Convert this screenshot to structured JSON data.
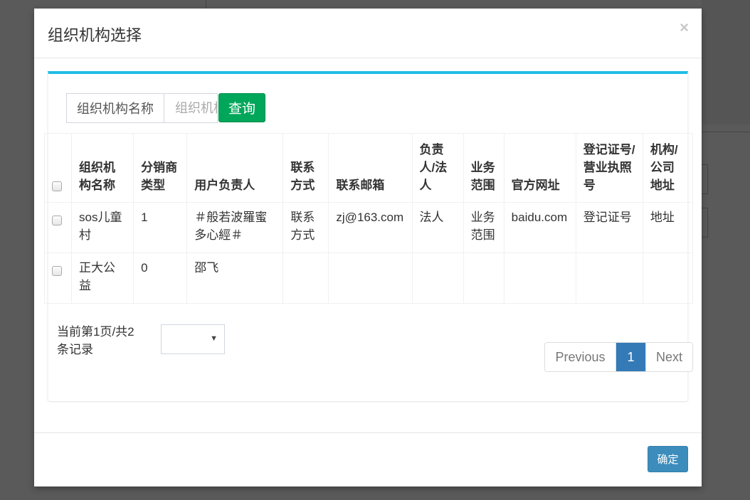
{
  "modal": {
    "title": "组织机构选择",
    "close_icon": "×",
    "confirm_label": "确定"
  },
  "search": {
    "label": "组织机构名称",
    "placeholder": "组织机构名称",
    "value": "",
    "button_label": "查询"
  },
  "table": {
    "columns": [
      "组织机构名称",
      "分销商类型",
      "用户负责人",
      "联系方式",
      "联系邮箱",
      "负责人/法人",
      "业务范围",
      "官方网址",
      "登记证号/营业执照号",
      "机构/公司地址"
    ],
    "rows": [
      {
        "checked": false,
        "cells": [
          "sos儿童村",
          "1",
          "＃般若波羅蜜多心經＃",
          "联系方式",
          "zj@163.com",
          "法人",
          "业务范围",
          "baidu.com",
          "登记证号",
          "地址"
        ]
      },
      {
        "checked": false,
        "cells": [
          "正大公益",
          "0",
          "邵飞",
          "",
          "",
          "",
          "",
          "",
          "",
          ""
        ]
      }
    ]
  },
  "footer": {
    "info": "当前第1页/共2条记录",
    "page_size_selected": "",
    "pagination": {
      "previous": "Previous",
      "current": "1",
      "next": "Next"
    }
  },
  "colors": {
    "accent_bar": "#1fbee6",
    "search_button": "#00a65a",
    "active_page": "#337ab7",
    "confirm_button": "#3c8dbc",
    "overlay": "#5a5a5a"
  }
}
